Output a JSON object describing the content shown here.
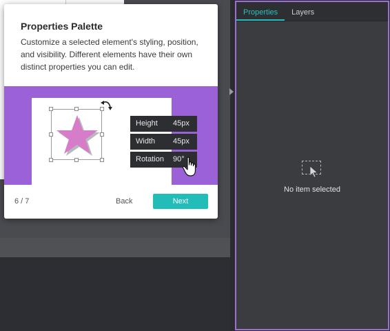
{
  "panel": {
    "tabs": [
      {
        "label": "Properties",
        "active": true
      },
      {
        "label": "Layers",
        "active": false
      }
    ],
    "empty_text": "No item selected",
    "accent": "#27c0c0",
    "border": "#9b6fd6"
  },
  "tutorial": {
    "title": "Properties Palette",
    "description": "Customize a selected element's styling, position, and visibility. Different elements have their own distinct properties you can edit.",
    "illustration": {
      "background": "#9a62d6",
      "star_color": "#d77cc8",
      "rows": [
        {
          "label": "Height",
          "value": "45px"
        },
        {
          "label": "Width",
          "value": "45px"
        },
        {
          "label": "Rotation",
          "value": "90°"
        }
      ]
    },
    "step": "6 / 7",
    "back_label": "Back",
    "next_label": "Next",
    "next_color": "#22bdb9"
  }
}
